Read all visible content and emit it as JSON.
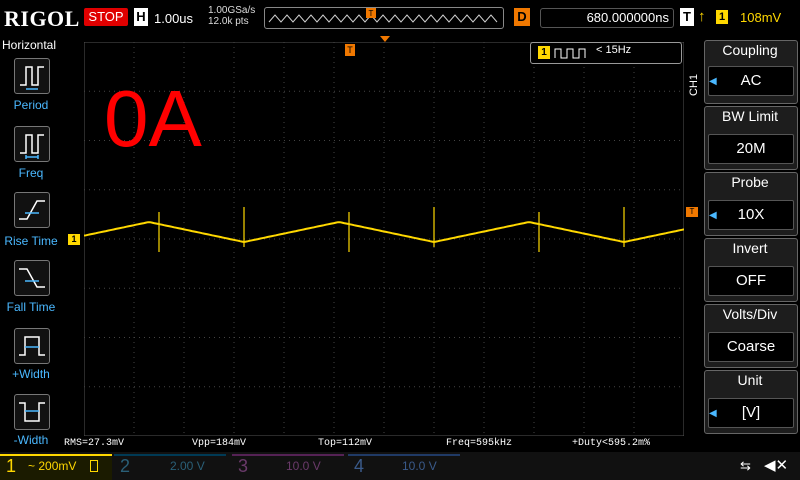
{
  "header": {
    "brand": "RIGOL",
    "run_state": "STOP",
    "timebase_badge": "H",
    "timebase": "1.00us",
    "sample_rate": "1.00GSa/s",
    "memory_depth": "12.0k pts",
    "delay_badge": "D",
    "delay": "680.000000ns",
    "trigger_badge": "T",
    "trigger_slope": "↑",
    "trigger_channel": "1",
    "trigger_level": "108mV"
  },
  "left_panel": {
    "title": "Horizontal",
    "items": [
      {
        "label": "Period",
        "icon": "period-icon"
      },
      {
        "label": "Freq",
        "icon": "freq-icon"
      },
      {
        "label": "Rise Time",
        "icon": "rise-time-icon"
      },
      {
        "label": "Fall Time",
        "icon": "fall-time-icon"
      },
      {
        "label": "+Width",
        "icon": "plus-width-icon"
      },
      {
        "label": "-Width",
        "icon": "minus-width-icon"
      }
    ]
  },
  "screen": {
    "overlay_text": "0A",
    "ch1_marker": "1",
    "trigger_marker": "T",
    "freq_counter_channel": "1",
    "freq_counter_value": "< 15Hz"
  },
  "right_panel": {
    "channel_tab": "CH1",
    "items": [
      {
        "label": "Coupling",
        "value": "AC",
        "has_arrow": true
      },
      {
        "label": "BW Limit",
        "value": "20M",
        "has_arrow": false
      },
      {
        "label": "Probe",
        "value": "10X",
        "has_arrow": true
      },
      {
        "label": "Invert",
        "value": "OFF",
        "has_arrow": false
      },
      {
        "label": "Volts/Div",
        "value": "Coarse",
        "has_arrow": false
      },
      {
        "label": "Unit",
        "value": "[V]",
        "has_arrow": true
      }
    ]
  },
  "measurements": {
    "rms": "RMS=27.3mV",
    "vpp": "Vpp=184mV",
    "top": "Top=112mV",
    "freq": "Freq=595kHz",
    "duty": "+Duty<595.2m%"
  },
  "channels": [
    {
      "num": "1",
      "value": "~ 200mV",
      "color": "#ffd800",
      "active": true
    },
    {
      "num": "2",
      "value": "2.00 V",
      "color": "#00b4ff",
      "active": false
    },
    {
      "num": "3",
      "value": "10.0 V",
      "color": "#e040e0",
      "active": false
    },
    {
      "num": "4",
      "value": "10.0 V",
      "color": "#3a7bff",
      "active": false
    }
  ],
  "colors": {
    "ch1": "#ffd800",
    "accent_blue": "#4ab8ff",
    "stop_red": "#e00000",
    "trigger_orange": "#f07800",
    "overlay_red": "#ff0000"
  }
}
